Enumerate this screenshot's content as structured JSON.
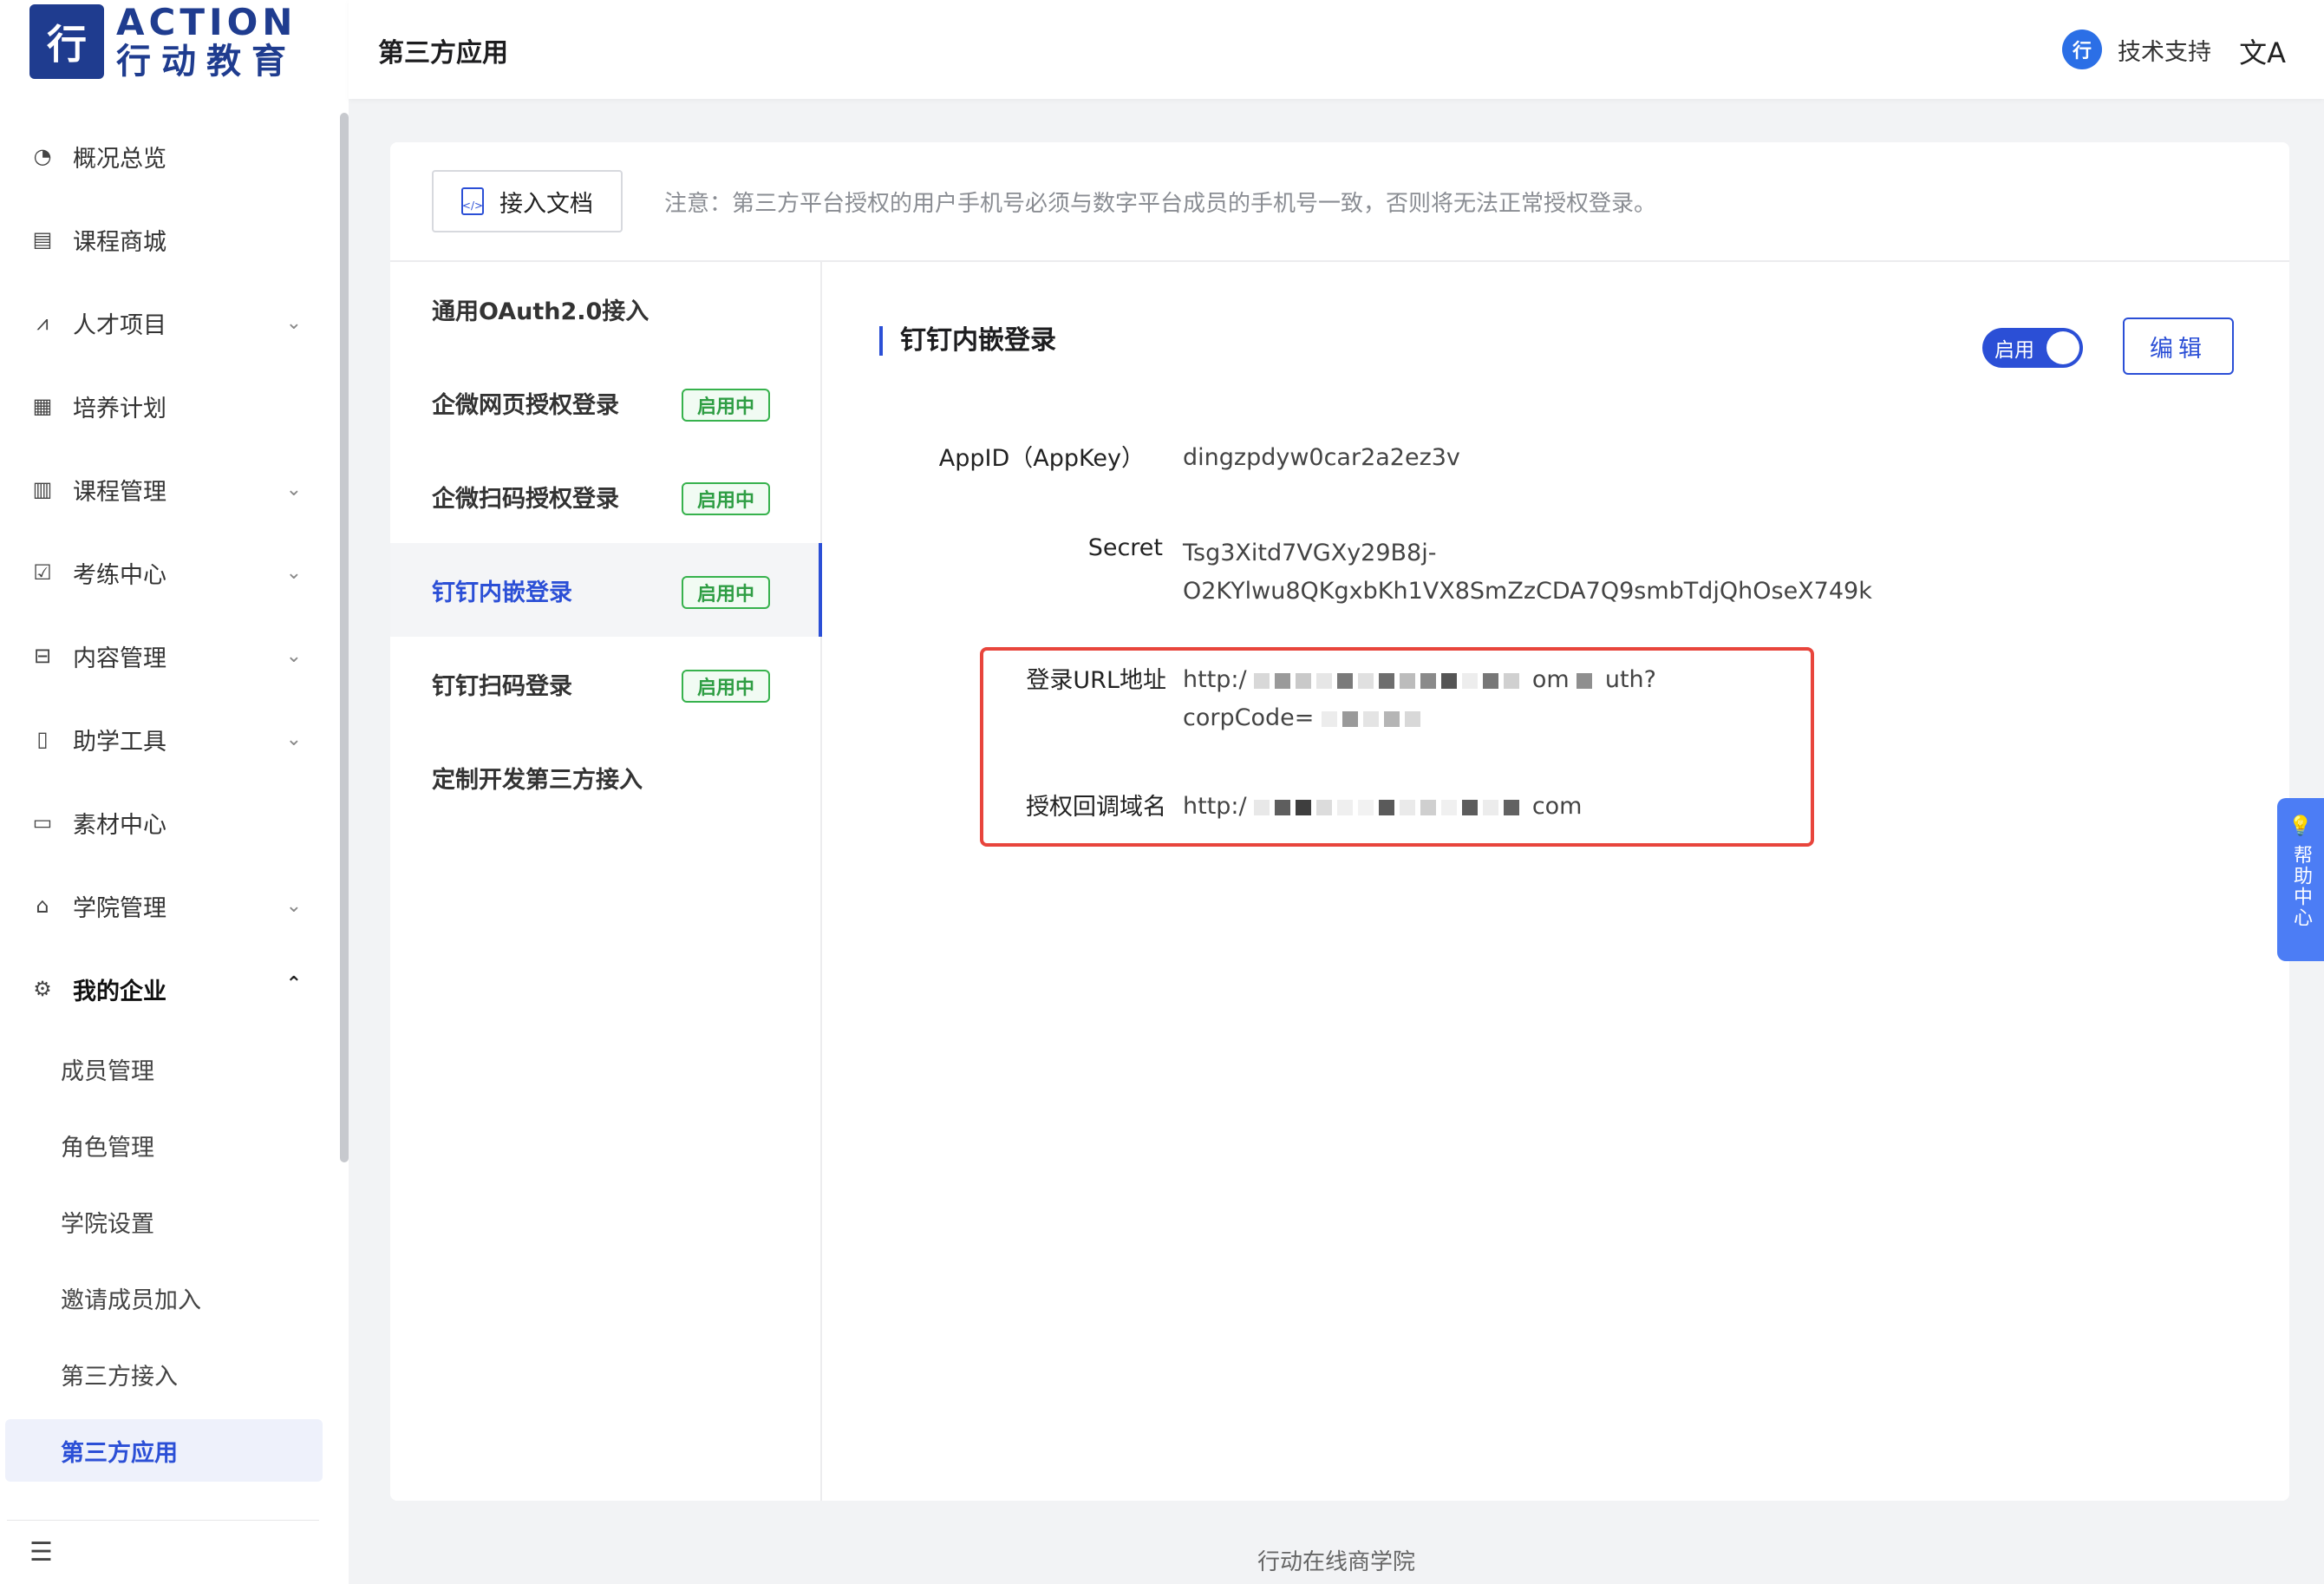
{
  "brand": {
    "logo_mark": "行",
    "name_en": "ACTION",
    "name_cn": "行动教育"
  },
  "sidebar": {
    "items": [
      {
        "label": "概况总览",
        "icon": "pie-chart-icon",
        "glyph": "◔",
        "has_chevron": false
      },
      {
        "label": "课程商城",
        "icon": "store-icon",
        "glyph": "▤",
        "has_chevron": false
      },
      {
        "label": "人才项目",
        "icon": "line-chart-icon",
        "glyph": "⩘",
        "has_chevron": true
      },
      {
        "label": "培养计划",
        "icon": "calendar-icon",
        "glyph": "▦",
        "has_chevron": false
      },
      {
        "label": "课程管理",
        "icon": "book-icon",
        "glyph": "▥",
        "has_chevron": true
      },
      {
        "label": "考练中心",
        "icon": "exam-icon",
        "glyph": "☑",
        "has_chevron": true
      },
      {
        "label": "内容管理",
        "icon": "box-icon",
        "glyph": "⊟",
        "has_chevron": true
      },
      {
        "label": "助学工具",
        "icon": "bookmark-icon",
        "glyph": "▯",
        "has_chevron": true
      },
      {
        "label": "素材中心",
        "icon": "folder-icon",
        "glyph": "▭",
        "has_chevron": false
      },
      {
        "label": "学院管理",
        "icon": "bank-icon",
        "glyph": "⌂",
        "has_chevron": true
      }
    ],
    "open_group": {
      "label": "我的企业",
      "icon": "gear-icon",
      "glyph": "⚙"
    },
    "sub_items": [
      "成员管理",
      "角色管理",
      "学院设置",
      "邀请成员加入",
      "第三方接入"
    ],
    "active_sub": "第三方应用"
  },
  "header": {
    "title": "第三方应用",
    "support_label": "技术支持",
    "support_glyph": "行",
    "lang_glyph": "文A"
  },
  "toolbar": {
    "doc_button": "接入文档",
    "notice": "注意：第三方平台授权的用户手机号必须与数字平台成员的手机号一致，否则将无法正常授权登录。"
  },
  "options": [
    {
      "label": "通用OAuth2.0接入",
      "badge": ""
    },
    {
      "label": "企微网页授权登录",
      "badge": "启用中"
    },
    {
      "label": "企微扫码授权登录",
      "badge": "启用中"
    },
    {
      "label": "钉钉内嵌登录",
      "badge": "启用中",
      "active": true
    },
    {
      "label": "钉钉扫码登录",
      "badge": "启用中"
    },
    {
      "label": "定制开发第三方接入",
      "badge": ""
    }
  ],
  "detail": {
    "title": "钉钉内嵌登录",
    "toggle_label": "启用",
    "edit_label": "编辑",
    "fields": {
      "appid_label": "AppID（AppKey）",
      "appid_value": "dingzpdyw0car2a2ez3v",
      "secret_label": "Secret",
      "secret_line1": "Tsg3Xitd7VGXy29B8j-",
      "secret_line2": "O2KYlwu8QKgxbKh1VX8SmZzCDA7Q9smbTdjQhOseX749k",
      "login_url_label": "登录URL地址",
      "login_url_visible_start": "http:/",
      "login_url_visible_mid": "om",
      "login_url_visible_end": "uth?",
      "login_url_line2": "corpCode=",
      "callback_label": "授权回调域名",
      "callback_visible_start": "http:/",
      "callback_visible_end": "com"
    }
  },
  "help": {
    "label": "帮助中心",
    "glyph": "💡"
  },
  "footer": {
    "text": "行动在线商学院"
  },
  "colors": {
    "accent": "#2b4fd6",
    "success": "#2f9e44",
    "highlight": "#e8453c",
    "help_tab": "#4c7df5"
  }
}
